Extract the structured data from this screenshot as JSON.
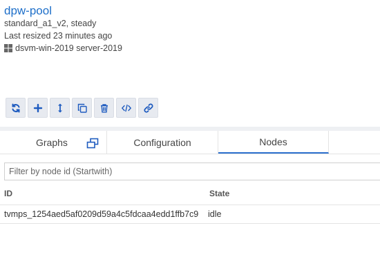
{
  "pool": {
    "name": "dpw-pool",
    "vm_state": "standard_a1_v2, steady",
    "resized": "Last resized 23 minutes ago",
    "os": "dsvm-win-2019 server-2019"
  },
  "toolbar": {
    "buttons": [
      {
        "name": "refresh-icon"
      },
      {
        "name": "add-icon"
      },
      {
        "name": "resize-icon"
      },
      {
        "name": "clone-icon"
      },
      {
        "name": "delete-icon"
      },
      {
        "name": "code-icon"
      },
      {
        "name": "link-icon"
      }
    ],
    "icon_color": "#1e5bbf"
  },
  "tabs": [
    {
      "label": "Graphs"
    },
    {
      "label": "Configuration"
    },
    {
      "label": "Nodes",
      "active": true
    }
  ],
  "filter": {
    "placeholder": "Filter by node id (Startwith)",
    "value": ""
  },
  "table": {
    "columns": [
      "ID",
      "State"
    ],
    "rows": [
      {
        "id": "tvmps_1254aed5af0209d59a4c5fdcaa4edd1ffb7c9",
        "state": "idle"
      }
    ]
  },
  "colors": {
    "link": "#1e6fc9",
    "active_tab": "#2b6fce",
    "button_bg": "#e7eaf0"
  }
}
